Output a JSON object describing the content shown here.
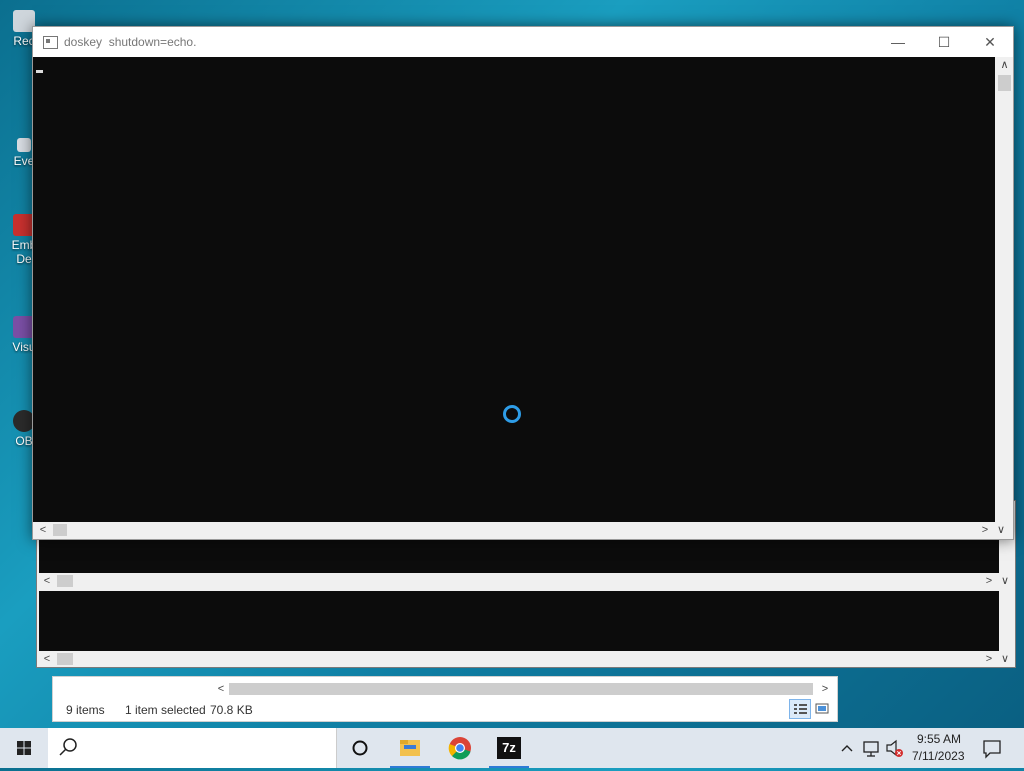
{
  "desktop": {
    "icons": [
      {
        "label": "Rec",
        "color": "#cfd6dc"
      },
      {
        "label": "Eve",
        "color": "#d8dde3"
      },
      {
        "label": "Emb",
        "label2": "De",
        "color": "#c8312f"
      },
      {
        "label": "Visu",
        "color": "#7b4fa6"
      },
      {
        "label": "OB",
        "color": "#2b2b2b"
      }
    ]
  },
  "console_window": {
    "title": "doskey  shutdown=echo.",
    "minimize_glyph": "—",
    "maximize_glyph": "☐",
    "close_glyph": "✕",
    "scroll_left": "<",
    "scroll_right": ">",
    "scroll_down": "∨",
    "scroll_up": "∧"
  },
  "background_windows": {
    "scroll_left": "<",
    "scroll_right": ">",
    "scroll_down": "∨"
  },
  "explorer": {
    "items_count": "9 items",
    "selection": "1 item selected",
    "selection_size": "70.8 KB",
    "scroll_left": "<",
    "scroll_right": ">"
  },
  "taskbar": {
    "time": "9:55 AM",
    "date": "7/11/2023",
    "pinned": [
      "Task View",
      "File Explorer",
      "Google Chrome",
      "7-Zip"
    ],
    "seven_zip_label": "7z",
    "tray_chevron": "^",
    "accent": "#2e7bd6"
  },
  "colors": {
    "console_bg": "#0c0c0c",
    "spinner": "#2e9de8"
  }
}
